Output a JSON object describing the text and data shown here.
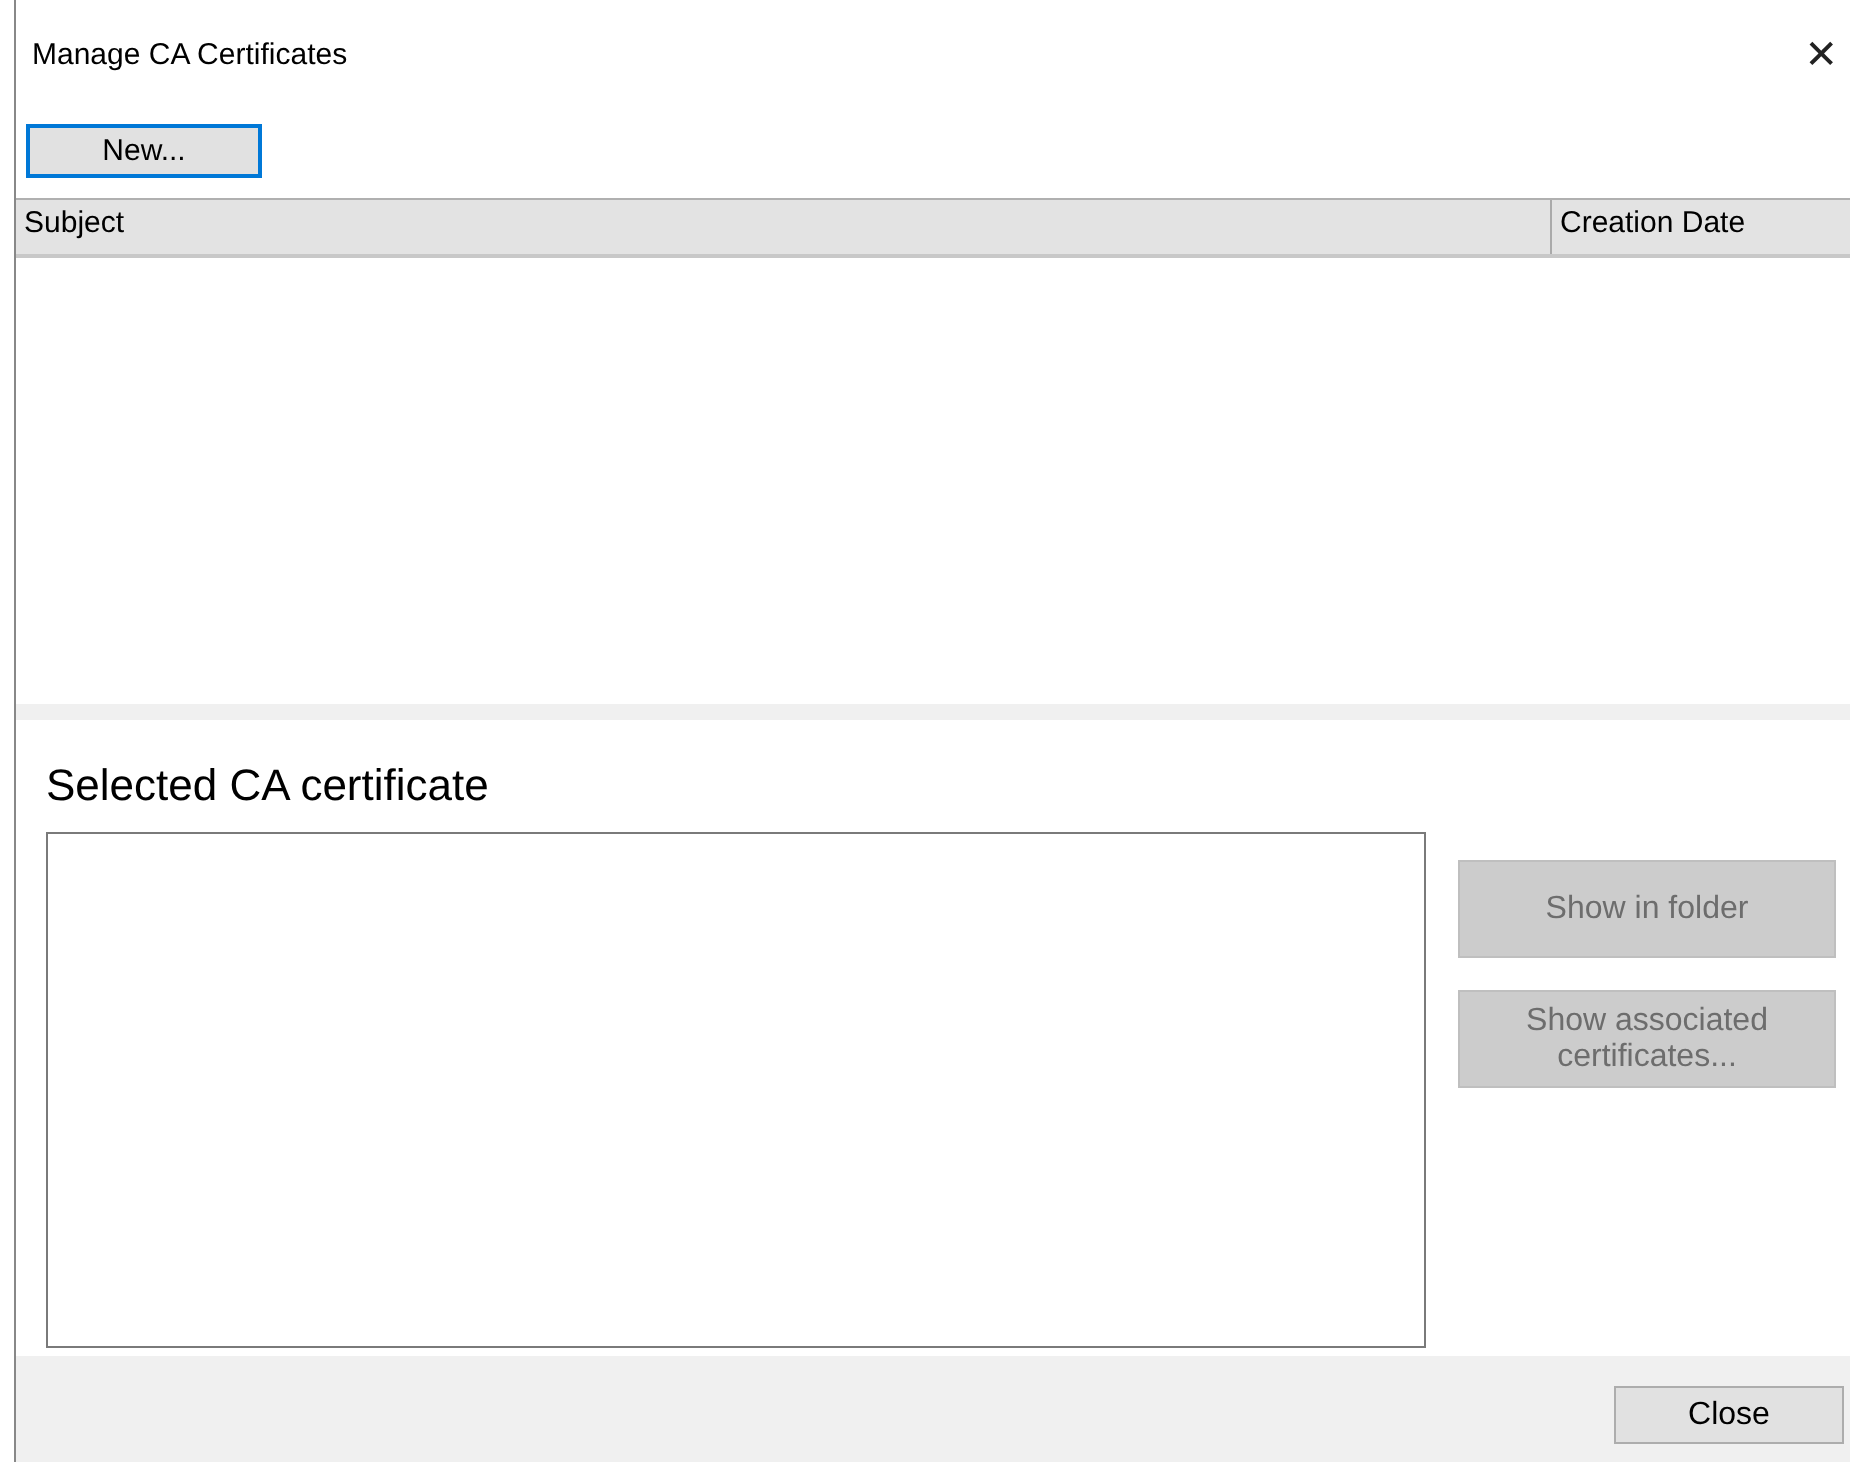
{
  "window": {
    "title": "Manage CA Certificates",
    "close_glyph": "✕"
  },
  "toolbar": {
    "buttons": [
      {
        "label": "New...",
        "focused": true
      }
    ]
  },
  "table": {
    "columns": [
      "Subject",
      "Creation Date"
    ]
  },
  "details": {
    "heading": "Selected CA certificate",
    "buttons": [
      {
        "label": "Show in folder",
        "disabled": true
      },
      {
        "label": "Show associated certificates...",
        "disabled": true
      }
    ]
  },
  "footer": {
    "buttons": [
      {
        "label": "Close",
        "disabled": false
      }
    ]
  }
}
